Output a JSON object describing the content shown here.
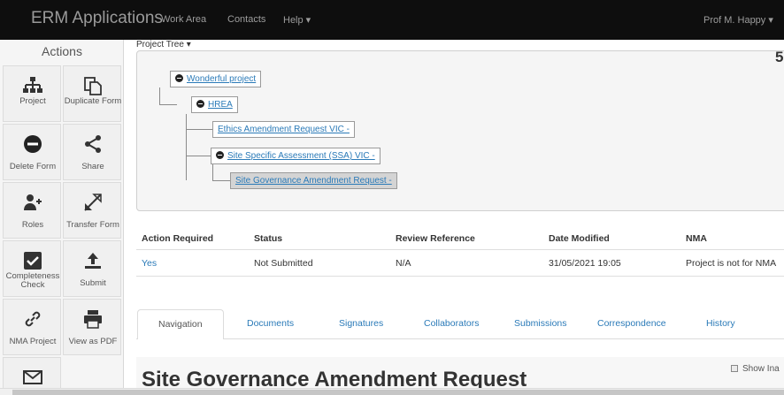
{
  "navbar": {
    "brand": "ERM Applications",
    "links": [
      "Work Area",
      "Contacts",
      "Help ▾"
    ],
    "user": "Prof M. Happy ▾"
  },
  "sidebar": {
    "title": "Actions",
    "buttons": [
      {
        "label": "Project",
        "icon": "sitemap-icon"
      },
      {
        "label": "Duplicate Form",
        "icon": "copy-icon"
      },
      {
        "label": "Delete Form",
        "icon": "minus-circle-icon"
      },
      {
        "label": "Share",
        "icon": "share-icon"
      },
      {
        "label": "Roles",
        "icon": "user-plus-icon"
      },
      {
        "label": "Transfer Form",
        "icon": "transfer-icon"
      },
      {
        "label": "Completeness Check",
        "icon": "check-square-icon"
      },
      {
        "label": "Submit",
        "icon": "upload-icon"
      },
      {
        "label": "NMA Project",
        "icon": "link-icon"
      },
      {
        "label": "View as PDF",
        "icon": "print-icon"
      },
      {
        "label": "",
        "icon": "envelope-icon"
      }
    ]
  },
  "project_tree": {
    "label": "Project Tree ▾",
    "corner_number": "5",
    "nodes": [
      "Wonderful project",
      "HREA",
      "Ethics Amendment Request VIC -",
      "Site Specific Assessment (SSA) VIC -",
      "Site Governance Amendment Request -"
    ]
  },
  "status_table": {
    "headers": [
      "Action Required",
      "Status",
      "Review Reference",
      "Date Modified",
      "NMA"
    ],
    "row": [
      "Yes",
      "Not Submitted",
      "N/A",
      "31/05/2021 19:05",
      "Project is not for NMA"
    ]
  },
  "tabs": [
    "Navigation",
    "Documents",
    "Signatures",
    "Collaborators",
    "Submissions",
    "Correspondence",
    "History"
  ],
  "content": {
    "heading": "Site Governance Amendment Request",
    "show_inactive": "Show Ina"
  }
}
